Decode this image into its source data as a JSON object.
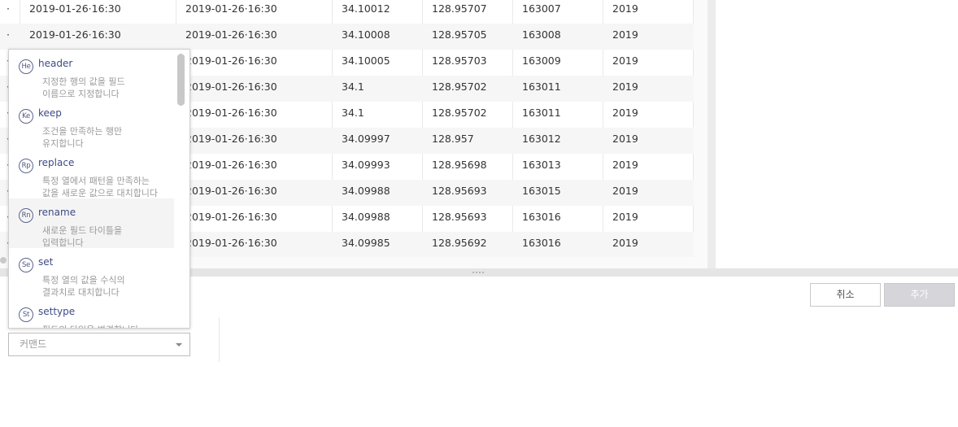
{
  "grid": {
    "rows": [
      {
        "c0": "·",
        "c1": "2019-01-26·16:30",
        "c2": "2019-01-26·16:30",
        "c3": "34.10012",
        "c4": "128.95707",
        "c5": "163007",
        "c6": "2019"
      },
      {
        "c0": "·",
        "c1": "2019-01-26·16:30",
        "c2": "2019-01-26·16:30",
        "c3": "34.10008",
        "c4": "128.95705",
        "c5": "163008",
        "c6": "2019"
      },
      {
        "c0": "·",
        "c1": "",
        "c2": "2019-01-26·16:30",
        "c3": "34.10005",
        "c4": "128.95703",
        "c5": "163009",
        "c6": "2019"
      },
      {
        "c0": "·",
        "c1": "",
        "c2": "2019-01-26·16:30",
        "c3": "34.1",
        "c4": "128.95702",
        "c5": "163011",
        "c6": "2019"
      },
      {
        "c0": "·",
        "c1": "",
        "c2": "2019-01-26·16:30",
        "c3": "34.1",
        "c4": "128.95702",
        "c5": "163011",
        "c6": "2019"
      },
      {
        "c0": "·",
        "c1": "",
        "c2": "2019-01-26·16:30",
        "c3": "34.09997",
        "c4": "128.957",
        "c5": "163012",
        "c6": "2019"
      },
      {
        "c0": "·",
        "c1": "",
        "c2": "2019-01-26·16:30",
        "c3": "34.09993",
        "c4": "128.95698",
        "c5": "163013",
        "c6": "2019"
      },
      {
        "c0": "·",
        "c1": "",
        "c2": "2019-01-26·16:30",
        "c3": "34.09988",
        "c4": "128.95693",
        "c5": "163015",
        "c6": "2019"
      },
      {
        "c0": "·",
        "c1": "",
        "c2": "2019-01-26·16:30",
        "c3": "34.09988",
        "c4": "128.95693",
        "c5": "163016",
        "c6": "2019"
      },
      {
        "c0": "·",
        "c1": "",
        "c2": "2019-01-26·16:30",
        "c3": "34.09985",
        "c4": "128.95692",
        "c5": "163016",
        "c6": "2019"
      }
    ]
  },
  "suggestions": [
    {
      "badge": "He",
      "name": "header",
      "desc": "지정한 행의 값을 필드\n이름으로 지정합니다"
    },
    {
      "badge": "Ke",
      "name": "keep",
      "desc": "조건을 만족하는 행만\n유지합니다"
    },
    {
      "badge": "Rp",
      "name": "replace",
      "desc": "특정 열에서 패턴을 만족하는\n값을 새로운 값으로 대치합니다"
    },
    {
      "badge": "Rn",
      "name": "rename",
      "desc": "새로운 필드 타이틀을\n입력합니다"
    },
    {
      "badge": "Se",
      "name": "set",
      "desc": "특정 열의 값을 수식의\n결과치로 대치합니다"
    },
    {
      "badge": "St",
      "name": "settype",
      "desc": "필드의 타입을 변경합니다"
    }
  ],
  "buttons": {
    "cancel": "취소",
    "add": "추가"
  },
  "command": {
    "placeholder": "커맨드"
  },
  "colors": {
    "accent_text": "#3e4a86",
    "add_button_bg": "#d6d6da",
    "highlight_row": "#f4f4f4"
  }
}
